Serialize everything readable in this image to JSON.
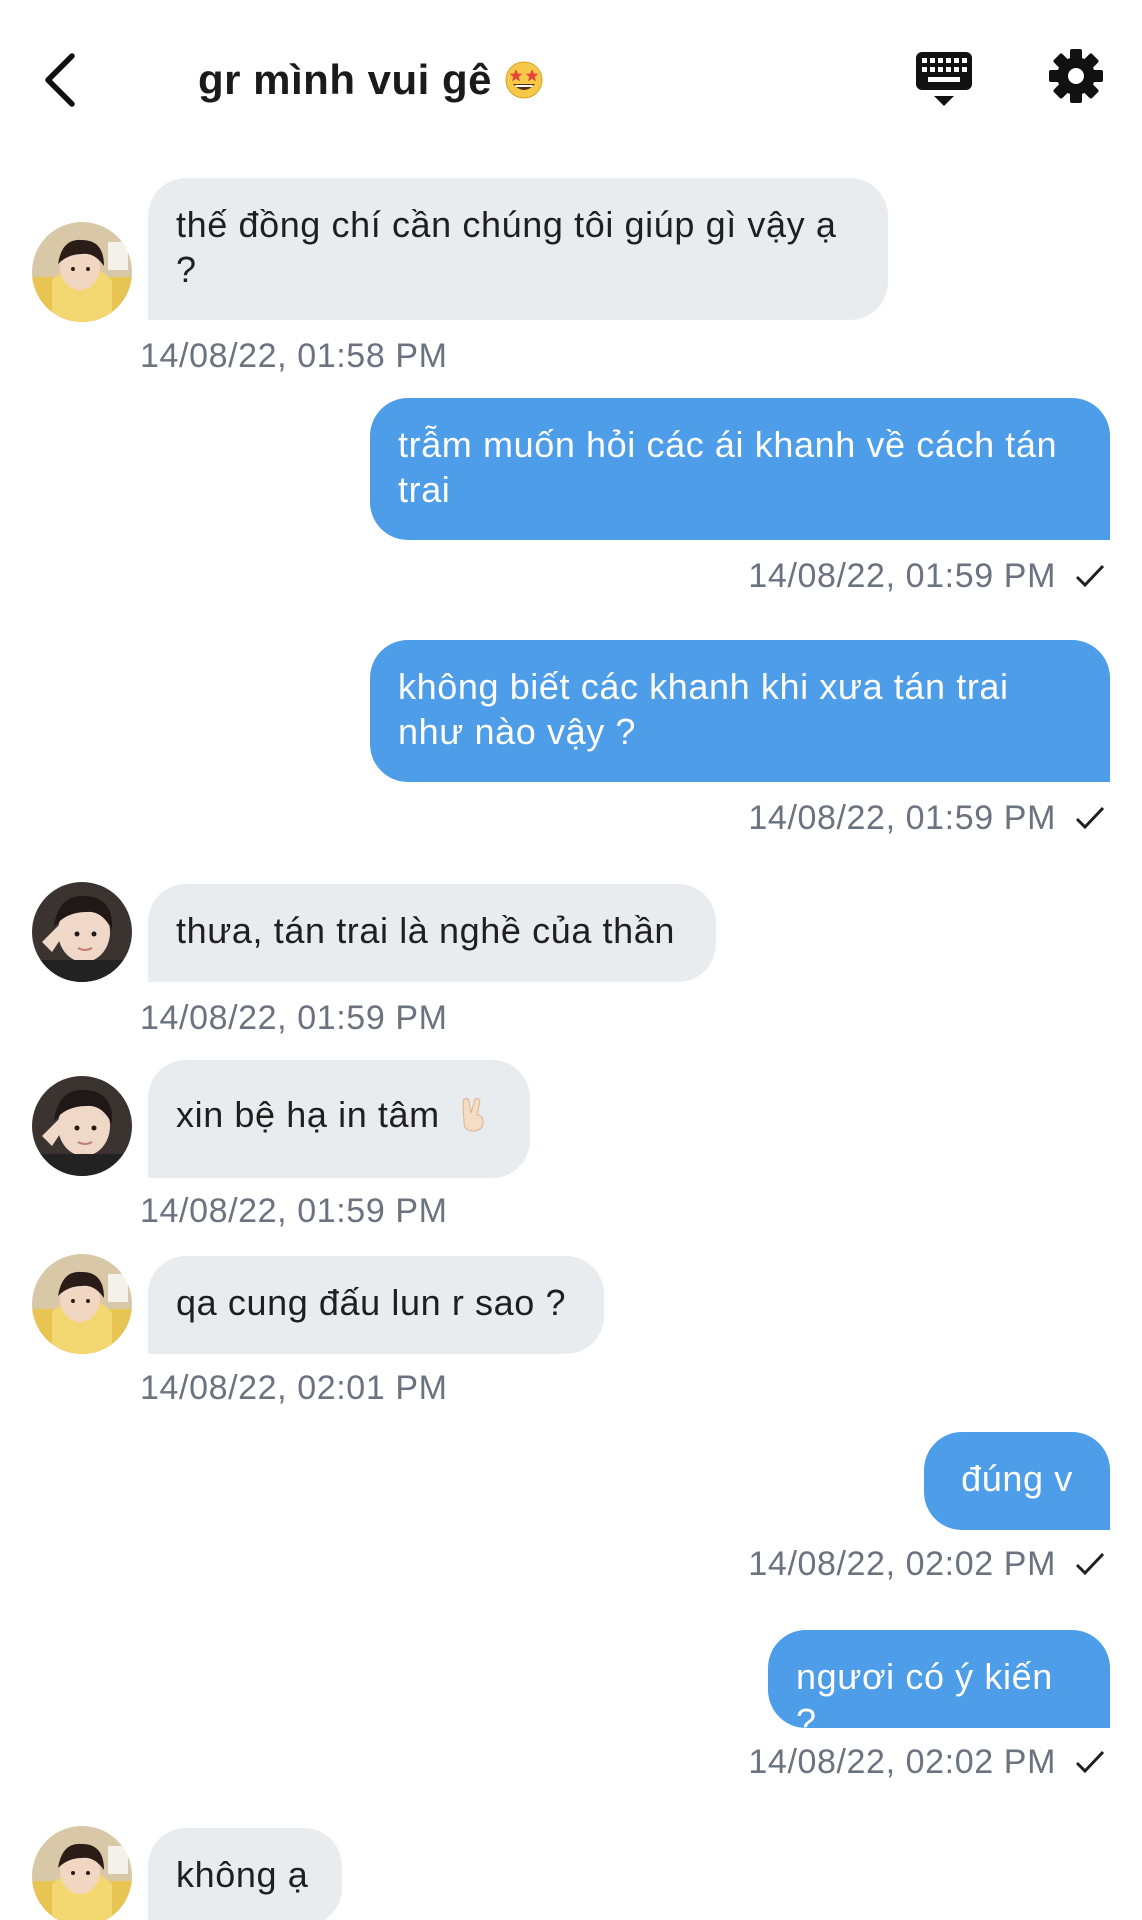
{
  "header": {
    "title": "gr mình vui gê",
    "title_emoji": "star-struck-emoji",
    "back_icon": "chevron-left-icon",
    "keyboard_icon": "keyboard-icon",
    "settings_icon": "gear-icon"
  },
  "colors": {
    "outgoing_bubble": "#4d9de8",
    "incoming_bubble": "#e9ecef",
    "timestamp": "#6b7280"
  },
  "messages": [
    {
      "direction": "in",
      "text": "thế đồng chí cần chúng tôi giúp gì vậy ạ ?",
      "time": "14/08/22, 01:58 PM"
    },
    {
      "direction": "out",
      "text": "trẫm muốn hỏi các ái khanh về cách tán trai",
      "time": "14/08/22, 01:59 PM",
      "status_icon": "checkmark-icon"
    },
    {
      "direction": "out",
      "text": "không biết các khanh khi xưa tán trai như nào vậy ?",
      "time": "14/08/22, 01:59 PM",
      "status_icon": "checkmark-icon"
    },
    {
      "direction": "in",
      "text": "thưa, tán trai là nghề của thần",
      "time": "14/08/22, 01:59 PM"
    },
    {
      "direction": "in",
      "text": "xin bệ hạ in tâm",
      "emoji": "victory-hand-emoji",
      "time": "14/08/22, 01:59 PM"
    },
    {
      "direction": "in",
      "text": "qa cung đấu lun r sao ?",
      "time": "14/08/22, 02:01 PM"
    },
    {
      "direction": "out",
      "text": "đúng v",
      "time": "14/08/22, 02:02 PM",
      "status_icon": "checkmark-icon"
    },
    {
      "direction": "out",
      "text": "ngươi có ý kiến ?",
      "time": "14/08/22, 02:02 PM",
      "status_icon": "checkmark-icon"
    },
    {
      "direction": "in",
      "text": "không ạ"
    }
  ]
}
